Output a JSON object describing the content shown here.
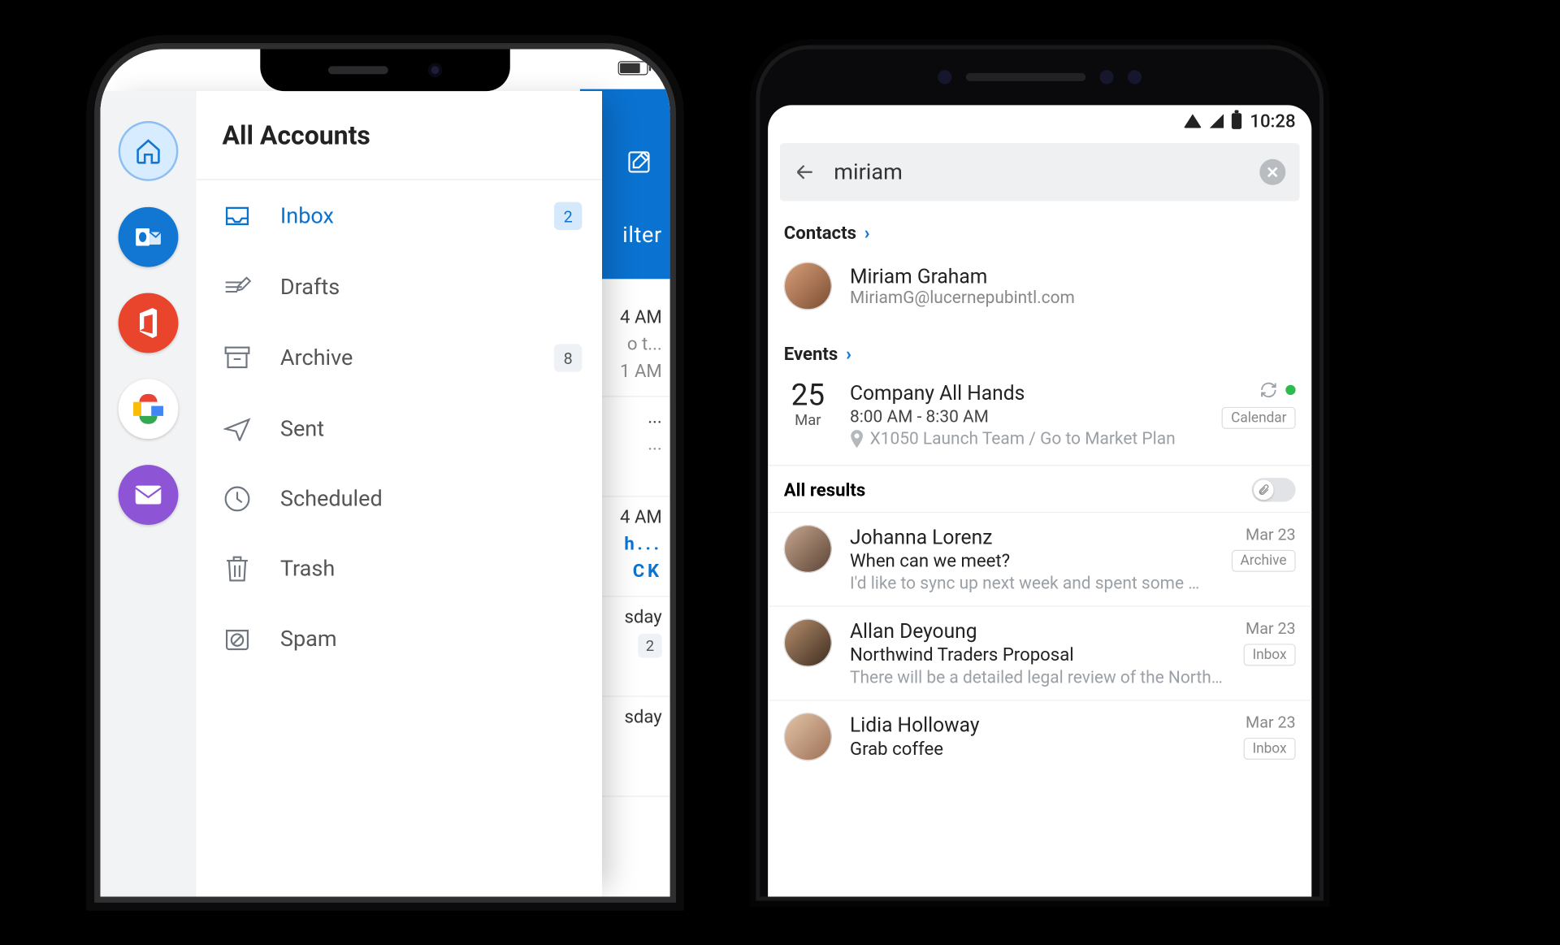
{
  "leftPhone": {
    "drawer": {
      "title": "All Accounts",
      "accounts": [
        {
          "name": "home",
          "semantic": "home-icon"
        },
        {
          "name": "outlook",
          "semantic": "outlook-icon"
        },
        {
          "name": "office",
          "semantic": "office-icon"
        },
        {
          "name": "google",
          "semantic": "google-icon"
        },
        {
          "name": "other",
          "semantic": "mail-icon"
        }
      ],
      "folders": [
        {
          "key": "inbox",
          "label": "Inbox",
          "badge": "2",
          "selected": true
        },
        {
          "key": "drafts",
          "label": "Drafts"
        },
        {
          "key": "archive",
          "label": "Archive",
          "badge": "8"
        },
        {
          "key": "sent",
          "label": "Sent"
        },
        {
          "key": "scheduled",
          "label": "Scheduled"
        },
        {
          "key": "trash",
          "label": "Trash"
        },
        {
          "key": "spam",
          "label": "Spam"
        }
      ]
    },
    "backgroundInbox": {
      "filter_label_fragment": "ilter",
      "rows": [
        {
          "time": "4 AM",
          "sub": "o t...",
          "extra": "1 AM"
        },
        {
          "time": "...",
          "sub": "..."
        },
        {
          "time": "4 AM",
          "sub": "h...",
          "kind": "blue",
          "blue": "CK"
        },
        {
          "time": "sday",
          "badge": "2"
        },
        {
          "time": "sday"
        }
      ]
    }
  },
  "rightPhone": {
    "status": {
      "time": "10:28"
    },
    "search": {
      "query": "miriam"
    },
    "sections": {
      "contacts_title": "Contacts",
      "events_title": "Events",
      "all_results_title": "All results"
    },
    "contact": {
      "name": "Miriam Graham",
      "email": "MiriamG@lucernepubintl.com"
    },
    "event": {
      "day": "25",
      "month": "Mar",
      "title": "Company All Hands",
      "time": "8:00 AM - 8:30 AM",
      "location": "X1050 Launch Team / Go to Market Plan",
      "source": "Calendar",
      "status": "recurring"
    },
    "mails": [
      {
        "from": "Johanna Lorenz",
        "subject": "When can we meet?",
        "preview": "I'd like to sync up next week and spent some mor…",
        "date": "Mar 23",
        "mailbox": "Archive"
      },
      {
        "from": "Allan Deyoung",
        "subject": "Northwind Traders Proposal",
        "preview": "There will be a detailed legal review of the Northw…",
        "date": "Mar 23",
        "mailbox": "Inbox"
      },
      {
        "from": "Lidia Holloway",
        "subject": "Grab coffee",
        "preview": "",
        "date": "Mar 23",
        "mailbox": "Inbox"
      }
    ]
  }
}
